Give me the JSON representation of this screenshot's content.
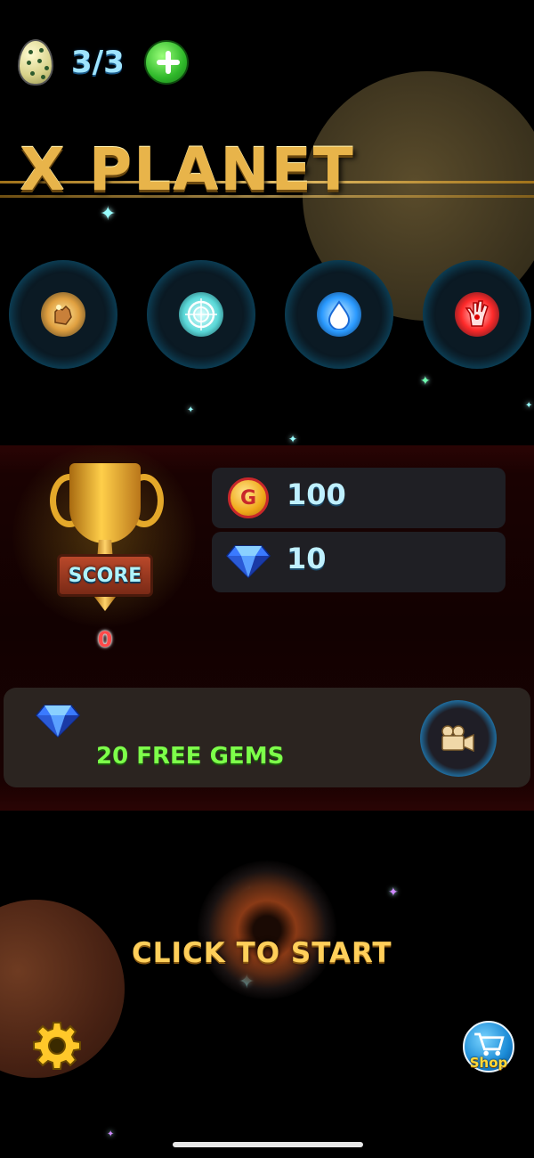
{
  "header": {
    "lives_text": "3/3",
    "add_lives_icon": "plus-icon",
    "egg_icon": "egg-icon"
  },
  "title": "X PLANET",
  "skills": [
    {
      "icon": "grab-hand-icon",
      "color": "#f0b84a"
    },
    {
      "icon": "target-crosshair-icon",
      "color": "#7ae6e6"
    },
    {
      "icon": "water-drop-icon",
      "color": "#4ab8ff"
    },
    {
      "icon": "red-hand-icon",
      "color": "#ff3030"
    }
  ],
  "score": {
    "label": "SCORE",
    "value": "0"
  },
  "resources": {
    "coin_symbol": "G",
    "coins": "100",
    "gems": "10"
  },
  "free_gems": {
    "label": "20 FREE GEMS",
    "action_icon": "video-camera-icon"
  },
  "start": {
    "label": "CLICK TO START"
  },
  "footer": {
    "settings_icon": "gear-icon",
    "shop_label": "Shop"
  },
  "colors": {
    "accent_gold": "#e8b44a",
    "gem_text": "#bff0ff",
    "free_gems_green": "#7dff4a",
    "score_red": "#ff4a4a"
  }
}
